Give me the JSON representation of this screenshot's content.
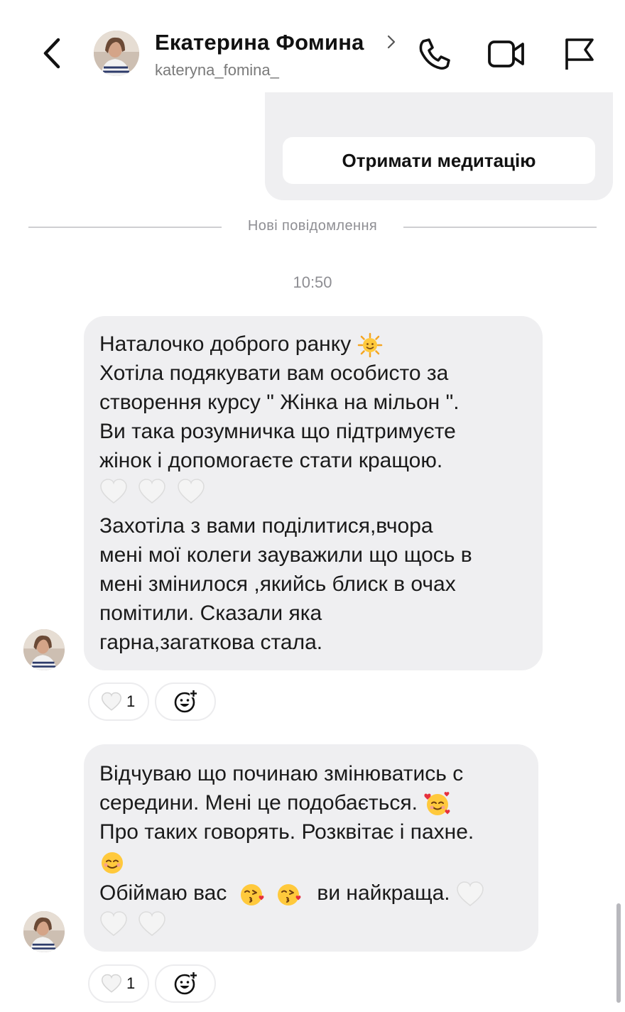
{
  "header": {
    "name": "Екатерина Фомина",
    "username": "kateryna_fomina_",
    "icons": [
      "back-icon",
      "chevron-right-icon",
      "phone-icon",
      "video-camera-icon",
      "flag-icon"
    ]
  },
  "previous_card": {
    "button_label": "Отримати медитацію"
  },
  "divider": {
    "label": "Нові повідомлення"
  },
  "timestamp": "10:50",
  "messages": [
    {
      "lines": [
        "Наталочко доброго ранку",
        "Хотіла подякувати вам особисто за",
        "створення курсу \" Жінка на мільон \".",
        "Ви така розумничка що підтримуєте",
        "жінок і допомогаєте стати кращою.",
        "",
        "Захотіла з вами поділитися,вчора",
        "мені мої колеги зауважили що щось в",
        "мені змінилося ,якийсь блиск в очах",
        "помітили. Сказали яка",
        "гарна,загаткова стала."
      ],
      "emojis": [
        "sun-with-face",
        "white-heart",
        "white-heart",
        "white-heart"
      ],
      "reaction": {
        "icon": "white-heart",
        "count": "1"
      }
    },
    {
      "lines": [
        "Відчуваю що починаю змінюватись с",
        "середини. Мені це подобається.",
        "Про таких говорять. Розквітає і пахне.",
        "",
        "Обіймаю вас",
        "ви найкраща."
      ],
      "emojis": [
        "smiling-face-with-hearts",
        "smiling-face",
        "face-blowing-kiss",
        "face-blowing-kiss",
        "white-heart",
        "white-heart",
        "white-heart"
      ],
      "reaction": {
        "icon": "white-heart",
        "count": "1"
      }
    }
  ],
  "colors": {
    "bubble": "#efeff1",
    "muted_text": "#8e8e93",
    "divider": "#cfcfd2"
  }
}
